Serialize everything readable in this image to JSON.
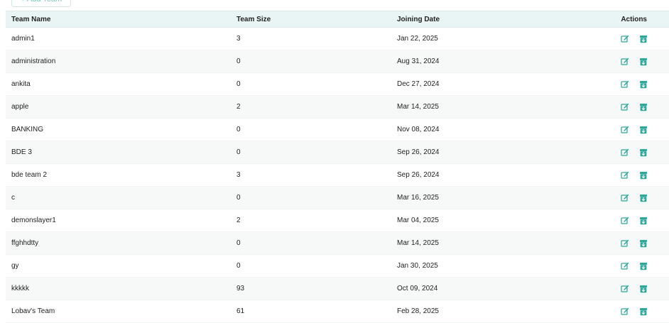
{
  "toolbar": {
    "add_team_label": "+ Add Team"
  },
  "table": {
    "headers": {
      "name": "Team Name",
      "size": "Team Size",
      "date": "Joining Date",
      "actions": "Actions"
    },
    "rows": [
      {
        "name": "admin1",
        "size": "3",
        "date": "Jan 22, 2025"
      },
      {
        "name": "administration",
        "size": "0",
        "date": "Aug 31, 2024"
      },
      {
        "name": "ankita",
        "size": "0",
        "date": "Dec 27, 2024"
      },
      {
        "name": "apple",
        "size": "2",
        "date": "Mar 14, 2025"
      },
      {
        "name": "BANKING",
        "size": "0",
        "date": "Nov 08, 2024"
      },
      {
        "name": "BDE 3",
        "size": "0",
        "date": "Sep 26, 2024"
      },
      {
        "name": "bde team 2",
        "size": "3",
        "date": "Sep 26, 2024"
      },
      {
        "name": "c",
        "size": "0",
        "date": "Mar 16, 2025"
      },
      {
        "name": "demonslayer1",
        "size": "2",
        "date": "Mar 04, 2025"
      },
      {
        "name": "ffghhdtty",
        "size": "0",
        "date": "Mar 14, 2025"
      },
      {
        "name": "gy",
        "size": "0",
        "date": "Jan 30, 2025"
      },
      {
        "name": "kkkkk",
        "size": "93",
        "date": "Oct 09, 2024"
      },
      {
        "name": "Lobav's Team",
        "size": "61",
        "date": "Feb 28, 2025"
      }
    ]
  },
  "icons": {
    "edit": "edit-icon",
    "archive": "archive-icon"
  },
  "colors": {
    "accent": "#2fa99a",
    "header_bg": "#e9f5f4"
  }
}
